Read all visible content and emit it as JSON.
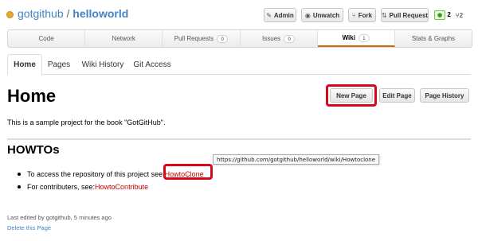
{
  "repo": {
    "owner": "gotgithub",
    "separator": " / ",
    "name": "helloworld"
  },
  "header_actions": [
    {
      "icon": "✎",
      "label": "Admin"
    },
    {
      "icon": "◉",
      "label": "Unwatch"
    },
    {
      "icon": "⑂",
      "label": "Fork"
    },
    {
      "icon": "⇅",
      "label": "Pull Request"
    }
  ],
  "watchers": {
    "icon": "◉",
    "count": "2"
  },
  "forks": {
    "icon": "⑂",
    "count": "2"
  },
  "main_nav": [
    {
      "label": "Code",
      "count": ""
    },
    {
      "label": "Network",
      "count": ""
    },
    {
      "label": "Pull Requests",
      "count": "0"
    },
    {
      "label": "Issues",
      "count": "0"
    },
    {
      "label": "Wiki",
      "count": "1"
    },
    {
      "label": "Stats & Graphs",
      "count": ""
    }
  ],
  "subnav": [
    "Home",
    "Pages",
    "Wiki History",
    "Git Access"
  ],
  "page": {
    "title": "Home",
    "actions": {
      "new_page": "New Page",
      "edit_page": "Edit Page",
      "page_history": "Page History"
    },
    "intro": "This is a sample project for the book \"GotGitHub\".",
    "section_title": "HOWTOs",
    "tooltip_url": "https://github.com/gotgithub/helloworld/wiki/Howtoclone",
    "bullets": [
      {
        "text": "To access the repository of this project see: ",
        "link": "HowtoClone"
      },
      {
        "text": "For contributers, see: ",
        "link": "HowtoContribute"
      }
    ],
    "last_edited": "Last edited by gotgithub, 5 minutes ago",
    "delete_link": "Delete this Page"
  },
  "colors": {
    "accent": "#d26911",
    "link": "#c80000",
    "repo_link": "#4183c4",
    "highlight": "#d40a1b"
  }
}
